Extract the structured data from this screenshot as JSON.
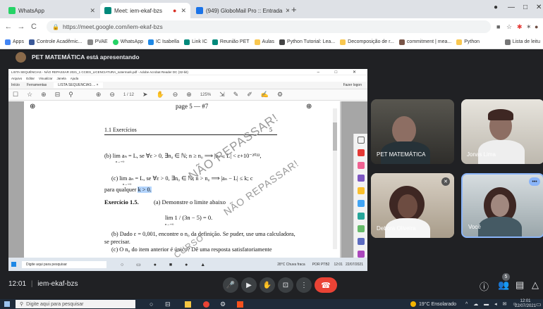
{
  "browser": {
    "tabs": [
      {
        "title": "WhatsApp",
        "active": false,
        "icon": "whatsapp-icon",
        "color": "#25d366"
      },
      {
        "title": "Meet: iem-ekaf-bzs",
        "active": true,
        "icon": "meet-icon",
        "color": "#00897b"
      },
      {
        "title": "(949) GloboMail Pro :: Entrada",
        "active": false,
        "icon": "mail-icon",
        "color": "#1a73e8"
      }
    ],
    "url": "https://meet.google.com/iem-ekaf-bzs",
    "bookmarks": [
      {
        "label": "Apps",
        "color": "#4285f4"
      },
      {
        "label": "Controle Acadêmic...",
        "color": "#3b5998"
      },
      {
        "label": "PVAE",
        "color": "#888"
      },
      {
        "label": "WhatsApp",
        "color": "#25d366"
      },
      {
        "label": "IC Isabella",
        "color": "#1e88e5"
      },
      {
        "label": "Link IC",
        "color": "#00897b"
      },
      {
        "label": "Reunião PET",
        "color": "#00897b"
      },
      {
        "label": "Aulas",
        "color": "#f9c74f"
      },
      {
        "label": "Python Tutorial: Lea...",
        "color": "#444"
      },
      {
        "label": "Decomposição de r...",
        "color": "#f9c74f"
      },
      {
        "label": "commitment | mea...",
        "color": "#795548"
      },
      {
        "label": "Python",
        "color": "#f9c74f"
      }
    ],
    "reading_list": "Lista de leitu"
  },
  "presenting": {
    "text": "PET MATEMÁTICA está apresentando"
  },
  "acrobat": {
    "title": "LISTA SEQUÊNCIAS - NÃO REPASSAR 2021_1 CCIES_LICENCIATURA_sotermark.pdf - Adobe Acrobat Reader DC (32-bit)",
    "menu": [
      "Arquivo",
      "Editar",
      "Visualizar",
      "Janela",
      "Ajuda"
    ],
    "tabs": [
      "Início",
      "Ferramentas",
      "LISTA SEQUENCIAS ... ×"
    ],
    "login": "Fazer logon",
    "page_indicator": "1 / 12",
    "zoom": "125%"
  },
  "doc": {
    "page_header": "page 5 — #7",
    "section": "1.1 Exercícios",
    "page_number": "5",
    "line_b": "(b) lim aₙ = L, se ∀ε > 0, ∃n₀ ∈ ℕ; n ≥ n₀ ⟹ |aₙ − L| < ε+10⁻²⁰²²,",
    "line_b_sub": "n→+∞",
    "line_c": "(c) lim aₙ = L, se ∀ε > 0, ∃n₀ ∈ ℕ; n > n₀ ⟹ |aₙ − L| ≤ k; c",
    "line_c_sub": "n→+∞",
    "line_c2_prefix": "para qualquer",
    "line_c2_highlight": "k > 0.",
    "ex_label": "Exercício 1.5.",
    "ex_a": "(a) Demonstre o limite abaixo",
    "limit_expr": "lim 1 / (3n − 5) = 0.",
    "limit_sub": "n→+∞",
    "ex_b": "(b) Dado ε = 0,001, encontre o n₀ da definição. Se puder, use uma calculadora,",
    "ex_b2": "se precisar.",
    "ex_c": "(c) O n₀ do item anterior é único? Dê uma resposta satisfatoriamente",
    "watermark": "NÃO REPASSAR!",
    "watermark2": "NÃO REPASSAR!",
    "watermark3": "CURSO"
  },
  "inner_taskbar": {
    "search": "Digite aqui para pesquisar",
    "weather": "28°C Chuva fraca",
    "lang": "POR PTB2",
    "time": "12:01",
    "date": "22/07/2021"
  },
  "participants": [
    {
      "name": "PET MATEMÁTICA"
    },
    {
      "name": "Jonas Lima"
    },
    {
      "name": "Debora Oliveira"
    },
    {
      "name": "Você"
    }
  ],
  "meeting": {
    "clock": "12:01",
    "code": "iem-ekaf-bzs",
    "participant_count": "5"
  },
  "os_taskbar": {
    "search": "Digite aqui para pesquisar",
    "weather": "19°C Ensolarado",
    "time": "12:01",
    "date": "22/07/2021"
  }
}
